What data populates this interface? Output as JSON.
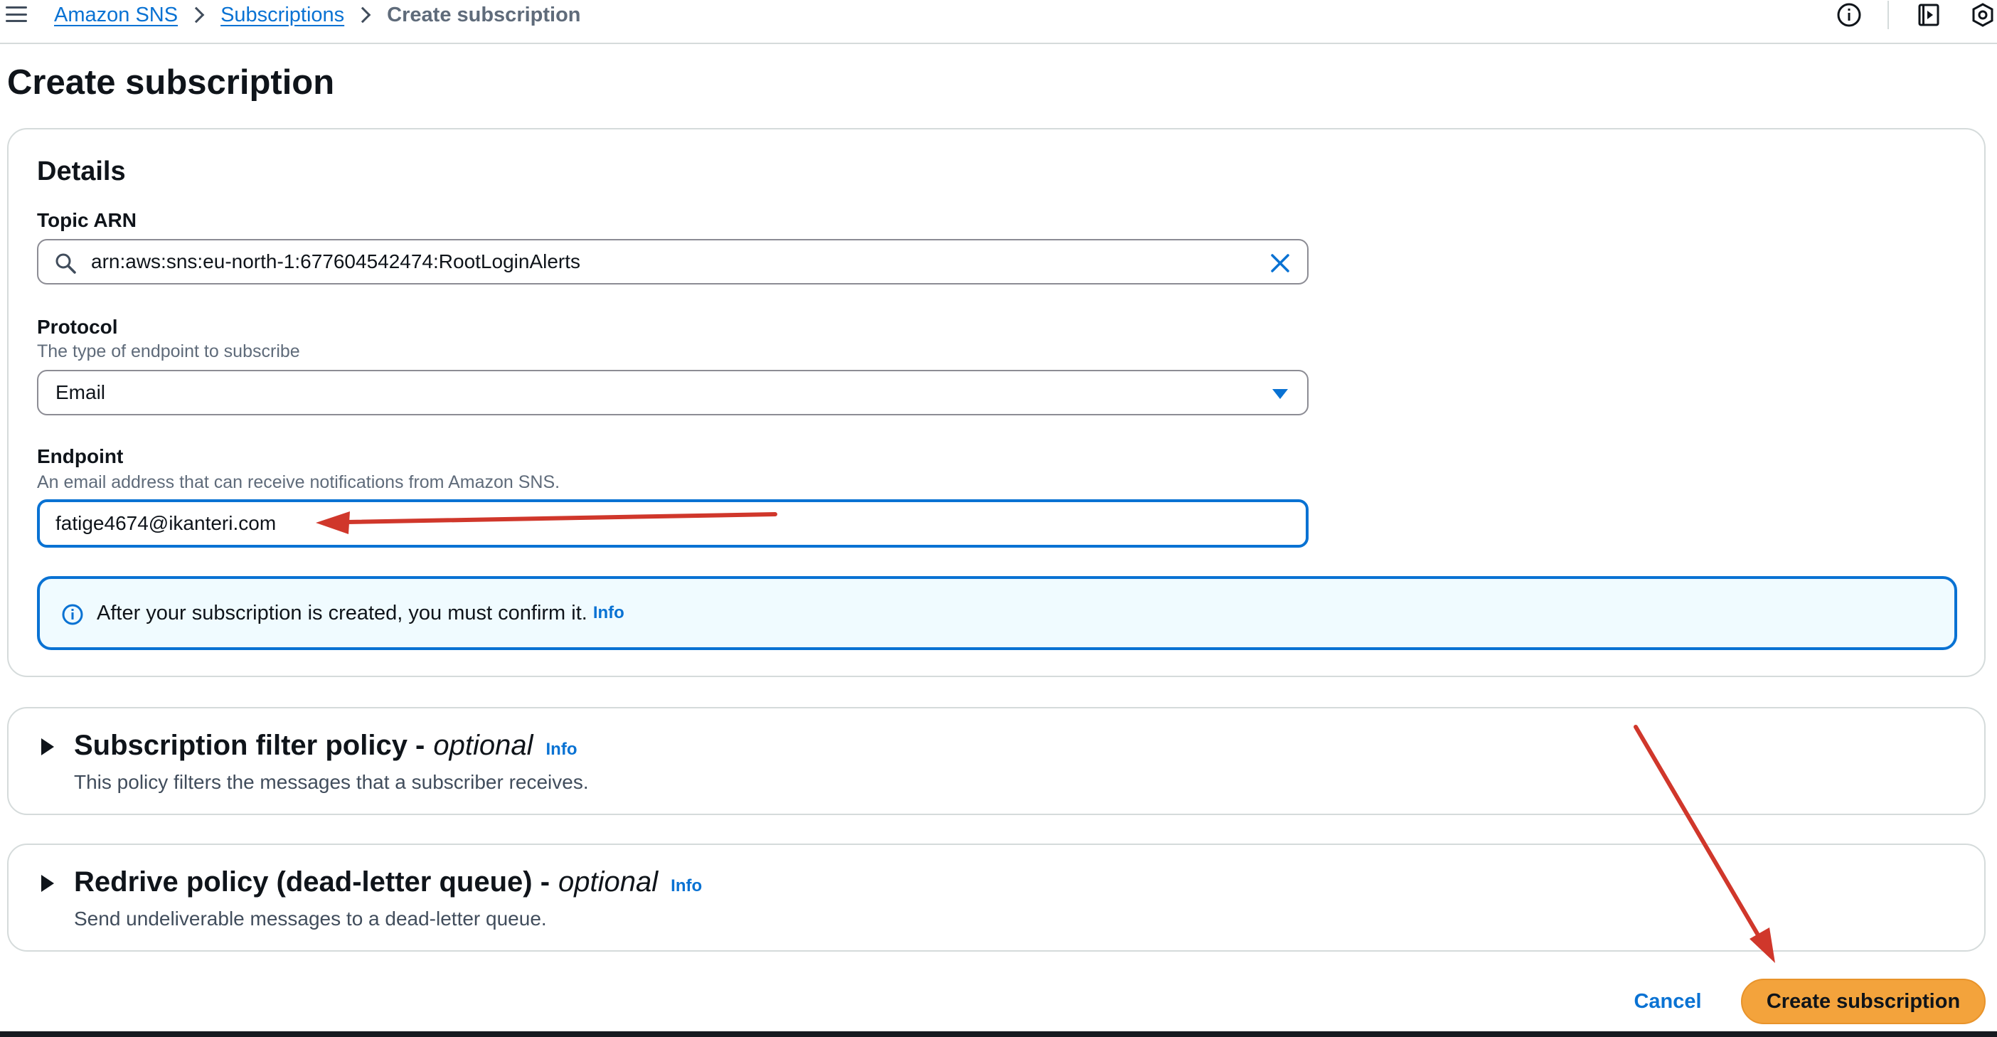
{
  "breadcrumb": {
    "items": [
      "Amazon SNS",
      "Subscriptions"
    ],
    "current": "Create subscription"
  },
  "page": {
    "title": "Create subscription"
  },
  "details": {
    "heading": "Details",
    "topic_arn": {
      "label": "Topic ARN",
      "value": "arn:aws:sns:eu-north-1:677604542474:RootLoginAlerts"
    },
    "protocol": {
      "label": "Protocol",
      "description": "The type of endpoint to subscribe",
      "value": "Email"
    },
    "endpoint": {
      "label": "Endpoint",
      "description": "An email address that can receive notifications from Amazon SNS.",
      "value": "fatige4674@ikanteri.com"
    },
    "alert": {
      "message": "After your subscription is created, you must confirm it.",
      "link": "Info"
    }
  },
  "filter_policy": {
    "title": "Subscription filter policy -",
    "optional": "optional",
    "info": "Info",
    "description": "This policy filters the messages that a subscriber receives."
  },
  "redrive_policy": {
    "title": "Redrive policy (dead-letter queue) -",
    "optional": "optional",
    "info": "Info",
    "description": "Send undeliverable messages to a dead-letter queue."
  },
  "actions": {
    "cancel": "Cancel",
    "create": "Create subscription"
  },
  "colors": {
    "link": "#0972d3",
    "primary_button": "#f3a33c",
    "alert_bg": "#f0fbff",
    "annotation_arrow": "#d0372b"
  },
  "icons": [
    "menu-icon",
    "info-icon",
    "notes-icon",
    "settings-icon",
    "search-icon",
    "clear-icon",
    "caret-down-icon",
    "info-circle-icon",
    "expand-caret-icon"
  ]
}
